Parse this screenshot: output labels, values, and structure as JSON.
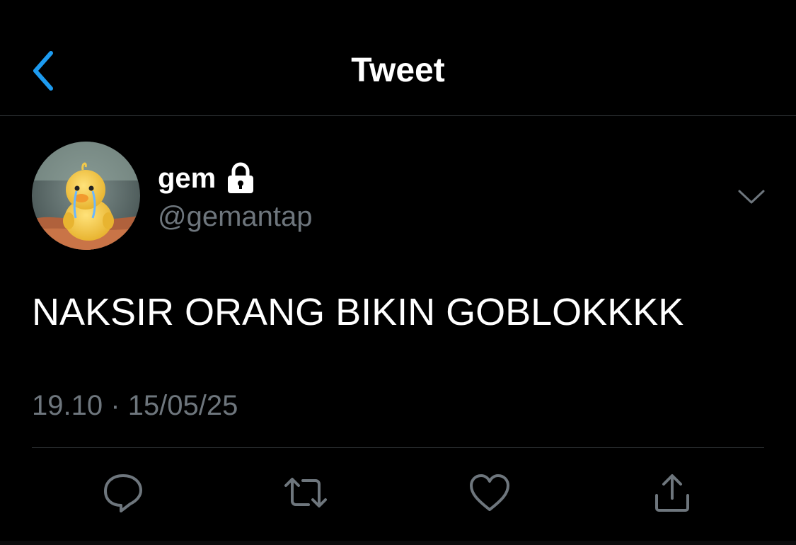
{
  "header": {
    "title": "Tweet",
    "back_icon": "chevron-left-icon"
  },
  "tweet": {
    "author": {
      "display_name": "gem",
      "handle": "@gemantap",
      "protected_icon": "lock-icon",
      "avatar": "avatar-yellow-duck-crying"
    },
    "text": "NAKSIR ORANG BIKIN GOBLOKKKK",
    "time": "19.10",
    "separator": "·",
    "date": "15/05/25",
    "more_icon": "chevron-down-icon"
  },
  "actions": [
    {
      "name": "reply",
      "icon": "speech-bubble-icon"
    },
    {
      "name": "retweet",
      "icon": "retweet-icon"
    },
    {
      "name": "like",
      "icon": "heart-icon"
    },
    {
      "name": "share",
      "icon": "share-icon"
    }
  ],
  "colors": {
    "background": "#000000",
    "accent": "#1d9bf0",
    "secondary_text": "#6e767d",
    "divider": "#2f3336"
  }
}
